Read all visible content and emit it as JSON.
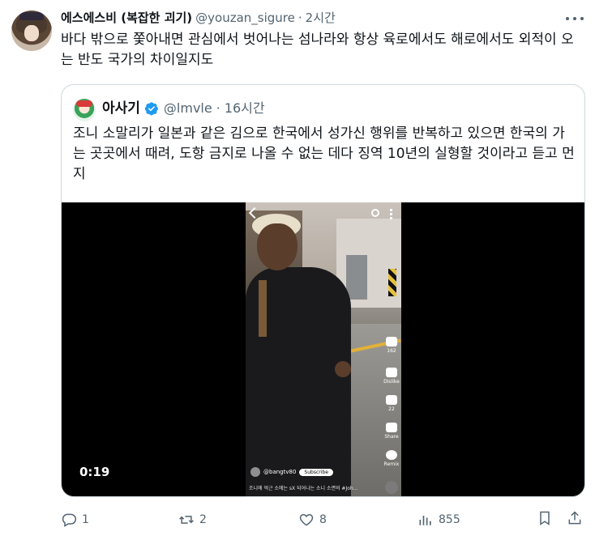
{
  "tweet": {
    "display_name": "에스에스비 (복잡한 괴기)",
    "handle": "@youzan_sigure",
    "dot": "·",
    "time": "2시간",
    "text": "바다 밖으로 쫓아내면 관심에서 벗어나는 섬나라와 항상 육로에서도 해로에서도 외적이 오는 반도 국가의 차이일지도"
  },
  "quote": {
    "display_name": "아사기",
    "verified": true,
    "handle": "@lmvle",
    "dot": "·",
    "time": "16시간",
    "text": "조니 소말리가 일본과 같은 김으로 한국에서 성가신 행위를 반복하고 있으면 한국의 가는 곳곳에서 때려, 도항 금지로 나올 수 없는 데다 징역 10년의 실형할 것이라고 듣고 먼지",
    "video": {
      "duration": "0:19",
      "overlay": {
        "like_count": "162",
        "dislike_label": "Dislike",
        "comment_count": "22",
        "share_label": "Share",
        "remix_label": "Remix",
        "channel": "@bangtv80",
        "subscribe_label": "Subscribe",
        "caption": "조니에 억근 소에는 sX 되어나는 소니 소면의 #Joh..."
      }
    }
  },
  "actions": {
    "replies": "1",
    "retweets": "2",
    "likes": "8",
    "views": "855"
  },
  "icons": [
    "more-icon",
    "verified-badge-icon",
    "reply-icon",
    "retweet-icon",
    "like-icon",
    "views-icon",
    "bookmark-icon",
    "share-icon"
  ],
  "colors": {
    "text": "#0f1419",
    "muted": "#536471",
    "border": "#cfd9de",
    "verified": "#1d9bf0"
  }
}
